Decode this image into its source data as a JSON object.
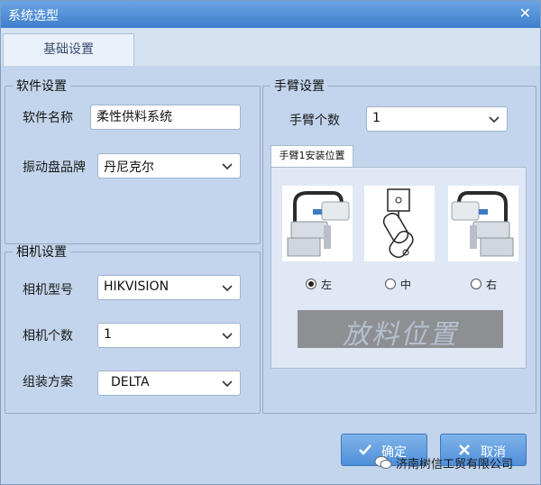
{
  "window": {
    "title": "系统选型",
    "close_glyph": "✕"
  },
  "tabs": [
    {
      "label": "基础设置",
      "selected": true
    }
  ],
  "software_settings": {
    "title": "软件设置",
    "name_label": "软件名称",
    "name_value": "柔性供料系统",
    "brand_label": "振动盘品牌",
    "brand_value": "丹尼克尔"
  },
  "camera_settings": {
    "title": "相机设置",
    "model_label": "相机型号",
    "model_value": "HIKVISION",
    "count_label": "相机个数",
    "count_value": "1",
    "scheme_label": "组装方案",
    "scheme_value": "DELTA"
  },
  "arm_settings": {
    "title": "手臂设置",
    "count_label": "手臂个数",
    "count_value": "1",
    "mount_tab": "手臂1安装位置",
    "positions": [
      {
        "label": "左",
        "selected": true
      },
      {
        "label": "中",
        "selected": false
      },
      {
        "label": "右",
        "selected": false
      }
    ],
    "place_label": "放料位置"
  },
  "buttons": {
    "ok_label": "确定",
    "cancel_label": "取消"
  },
  "watermark": "济南树信工贸有限公司",
  "colors": {
    "title_bar": "#3e7fcc",
    "window_bg": "#c3d5ec",
    "button": "#4f8fd9",
    "place_box": "#8d8f92"
  },
  "icons": {
    "close": "close-icon",
    "dropdown": "chevron-down-icon",
    "ok": "check-icon",
    "cancel": "x-icon"
  }
}
